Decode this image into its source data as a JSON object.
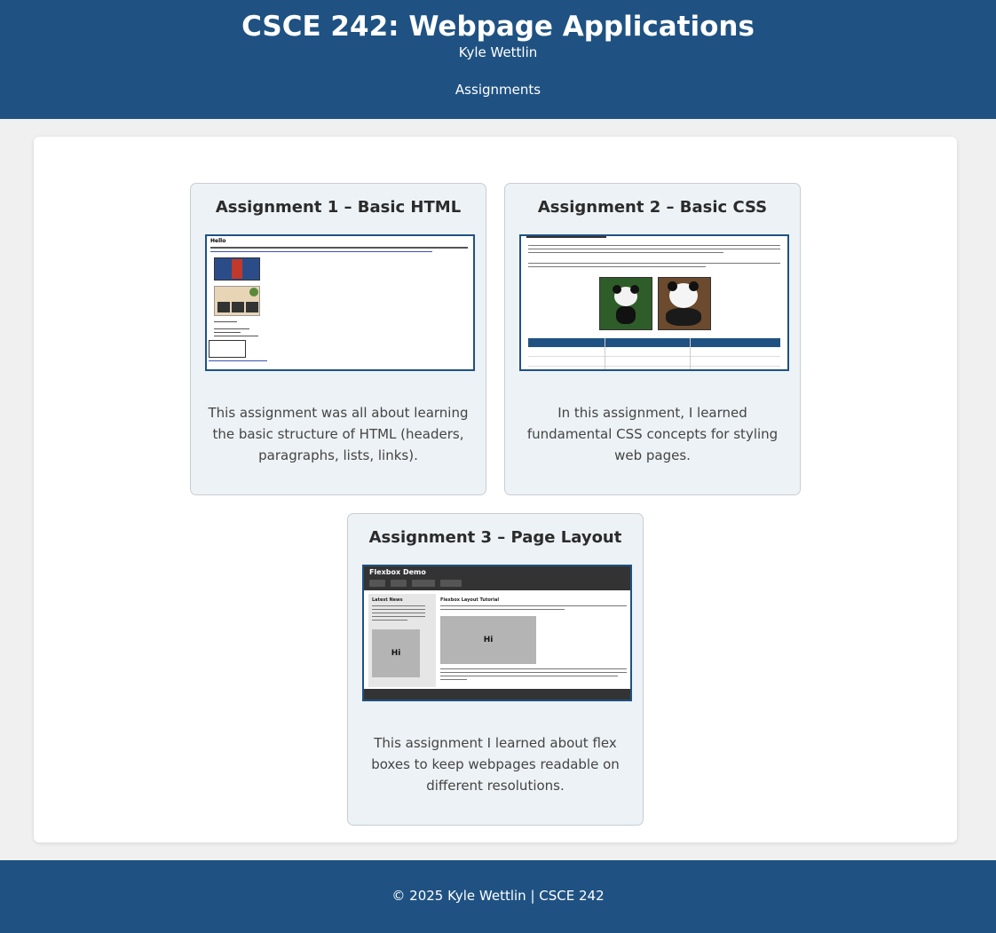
{
  "header": {
    "title": "CSCE 242: Webpage Applications",
    "subtitle": "Kyle Wettlin",
    "nav": [
      "Assignments"
    ]
  },
  "assignments": [
    {
      "title": "Assignment 1 – Basic HTML",
      "description": "This assignment was all about learning the basic structure of HTML (headers, paragraphs, lists, links).",
      "thumbnail": {
        "heading": "Hello"
      }
    },
    {
      "title": "Assignment 2 – Basic CSS",
      "description": "In this assignment, I learned fundamental CSS concepts for styling web pages."
    },
    {
      "title": "Assignment 3 – Page Layout",
      "description": "This assignment I learned about flex boxes to keep webpages readable on different resolutions.",
      "thumbnail": {
        "header": "Flexbox Demo",
        "sidebar_title": "Latest News",
        "main_title": "Flexbox Layout Tutorial",
        "box_text": "Hi"
      }
    }
  ],
  "footer": {
    "copyright": "© 2025 Kyle Wettlin | CSCE 242"
  },
  "colors": {
    "primary": "#1f5282",
    "card_bg": "#edf2f6",
    "page_bg": "#f0f0f0"
  }
}
